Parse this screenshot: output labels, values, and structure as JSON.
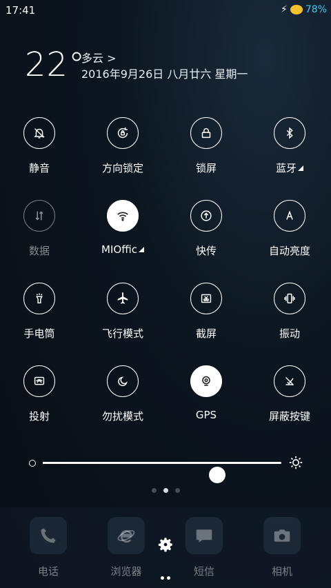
{
  "status": {
    "time": "17:41",
    "battery": "78%"
  },
  "weather": {
    "temperature": "22°",
    "condition": "多云 >",
    "date": "2016年9月26日 八月廿六 星期一"
  },
  "toggles": [
    {
      "label": "静音",
      "icon": "mute-bell-icon",
      "state": "off"
    },
    {
      "label": "方向锁定",
      "icon": "rotation-lock-icon",
      "state": "off"
    },
    {
      "label": "锁屏",
      "icon": "lock-icon",
      "state": "off"
    },
    {
      "label": "蓝牙",
      "icon": "bluetooth-icon",
      "state": "off"
    },
    {
      "label": "数据",
      "icon": "mobile-data-icon",
      "state": "disabled"
    },
    {
      "label": "MIOffic",
      "icon": "wifi-icon",
      "state": "on"
    },
    {
      "label": "快传",
      "icon": "upload-icon",
      "state": "off"
    },
    {
      "label": "自动亮度",
      "icon": "auto-brightness-icon",
      "state": "off"
    },
    {
      "label": "手电筒",
      "icon": "flashlight-icon",
      "state": "off"
    },
    {
      "label": "飞行模式",
      "icon": "airplane-icon",
      "state": "off"
    },
    {
      "label": "截屏",
      "icon": "screenshot-icon",
      "state": "off"
    },
    {
      "label": "振动",
      "icon": "vibrate-icon",
      "state": "off"
    },
    {
      "label": "投射",
      "icon": "cast-icon",
      "state": "off"
    },
    {
      "label": "勿扰模式",
      "icon": "moon-icon",
      "state": "off"
    },
    {
      "label": "GPS",
      "icon": "gps-icon",
      "state": "on"
    },
    {
      "label": "屏蔽按键",
      "icon": "block-keys-icon",
      "state": "off"
    }
  ],
  "brightness": {
    "level": 0.73
  },
  "dock": {
    "apps": [
      {
        "label": "电话",
        "icon": "phone-icon"
      },
      {
        "label": "浏览器",
        "icon": "browser-icon"
      },
      {
        "label": "短信",
        "icon": "message-icon"
      },
      {
        "label": "相机",
        "icon": "camera-icon"
      }
    ]
  }
}
